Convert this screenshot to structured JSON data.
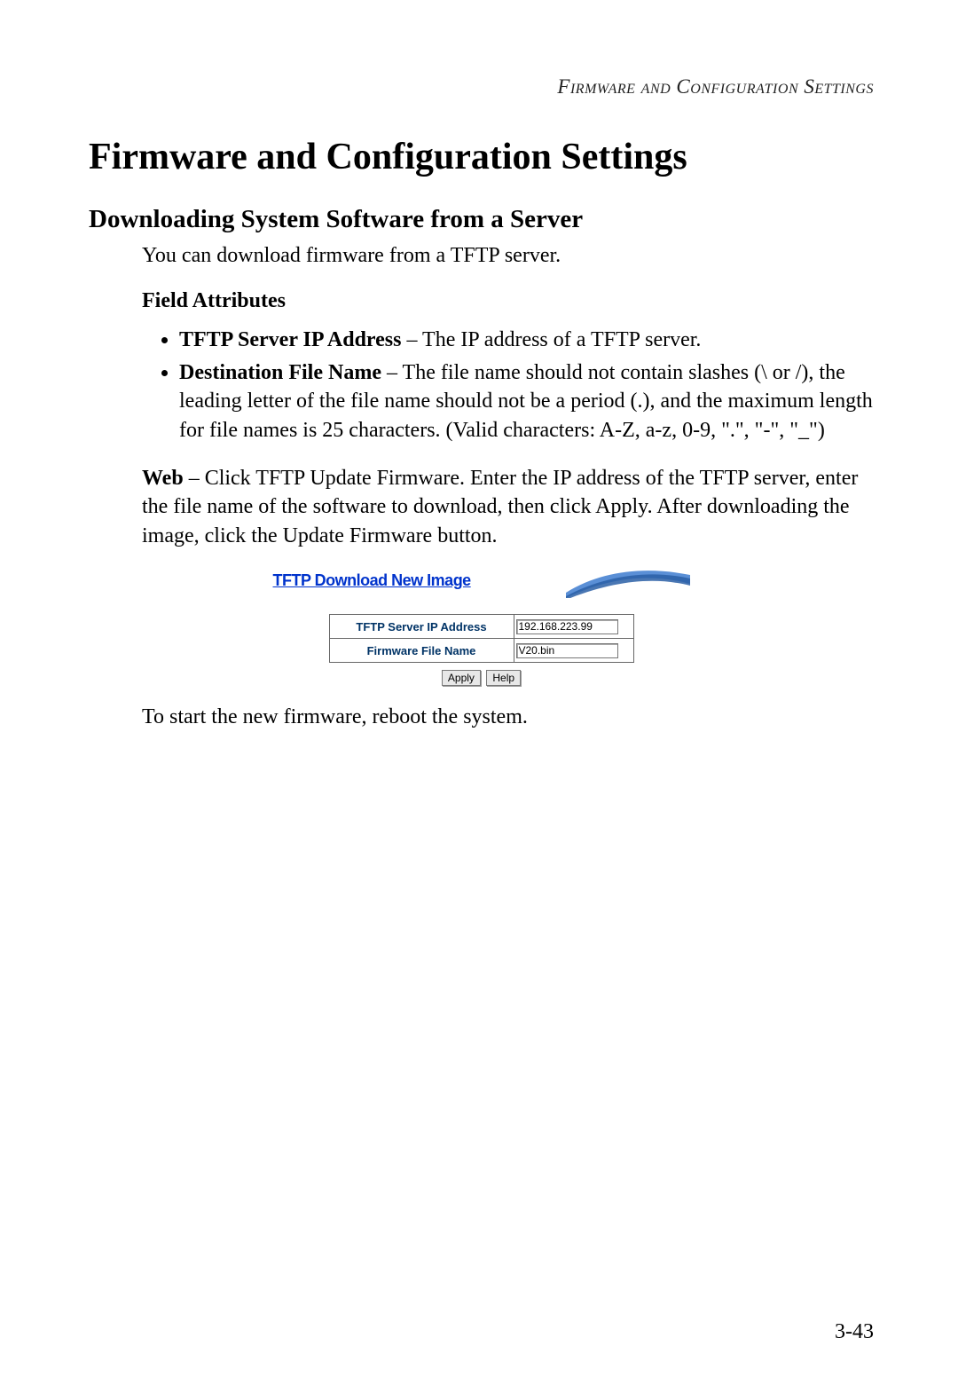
{
  "running_head": "Firmware and Configuration Settings",
  "title": "Firmware and Configuration Settings",
  "section": "Downloading System Software from a Server",
  "intro": "You can download firmware from a TFTP server.",
  "field_attributes_heading": "Field Attributes",
  "attributes": [
    {
      "label": "TFTP Server IP Address",
      "desc": " – The IP address of a TFTP server."
    },
    {
      "label": "Destination File Name",
      "desc": " – The file name should not contain slashes (\\ or /), the leading letter of the file name should not be a period (.), and the maximum length for file names is 25 characters. (Valid characters: A-Z, a-z, 0-9, \".\", \"-\", \"_\")"
    }
  ],
  "web_label": "Web",
  "web_text": " – Click TFTP Update Firmware. Enter the IP address of the TFTP server, enter the file name of the software to download, then click Apply. After downloading the image, click the Update Firmware button.",
  "ui": {
    "title": "TFTP Download New Image",
    "row1_label": "TFTP Server IP Address",
    "row1_value": "192.168.223.99",
    "row2_label": "Firmware File Name",
    "row2_value": "V20.bin",
    "apply": "Apply",
    "help": "Help"
  },
  "after_shot": "To start the new firmware, reboot the system.",
  "page_number": "3-43"
}
